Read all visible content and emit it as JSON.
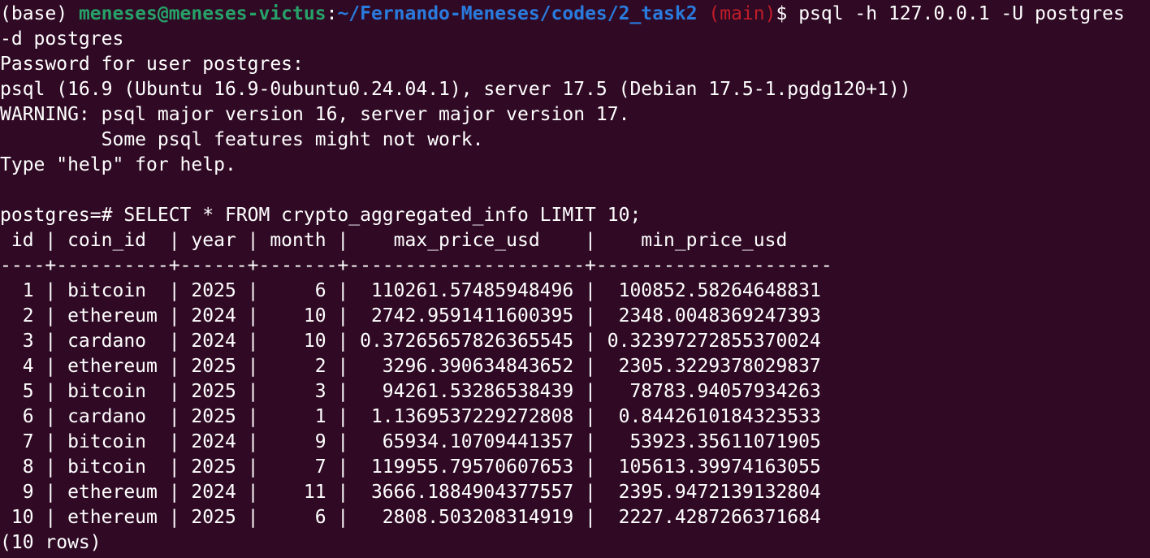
{
  "prompt": {
    "env": "(base) ",
    "user_host": "meneses@meneses-victus",
    "colon": ":",
    "path": "~/Fernando-Meneses/codes/2_task2",
    "branch": " (main)",
    "dollar": "$ ",
    "command": "psql -h 127.0.0.1 -U postgres",
    "command_cont": "-d postgres"
  },
  "output": {
    "password_prompt": "Password for user postgres:",
    "version_line": "psql (16.9 (Ubuntu 16.9-0ubuntu0.24.04.1), server 17.5 (Debian 17.5-1.pgdg120+1))",
    "warning_line1": "WARNING: psql major version 16, server major version 17.",
    "warning_line2": "         Some psql features might not work.",
    "help_line": "Type \"help\" for help.",
    "blank": "",
    "query_line": "postgres=# SELECT * FROM crypto_aggregated_info LIMIT 10;",
    "header_line": " id | coin_id  | year | month |    max_price_usd    |    min_price_usd",
    "separator_line": "----+----------+------+-------+---------------------+---------------------",
    "rows": [
      "  1 | bitcoin  | 2025 |     6 |  110261.57485948496 |  100852.58264648831",
      "  2 | ethereum | 2024 |    10 |  2742.9591411600395 |  2348.0048369247393",
      "  3 | cardano  | 2024 |    10 | 0.37265657826365545 | 0.32397272855370024",
      "  4 | ethereum | 2025 |     2 |   3296.390634843652 |  2305.3229378029837",
      "  5 | bitcoin  | 2025 |     3 |   94261.53286538439 |   78783.94057934263",
      "  6 | cardano  | 2025 |     1 |  1.1369537229272808 |  0.8442610184323533",
      "  7 | bitcoin  | 2024 |     9 |   65934.10709441357 |   53923.35611071905",
      "  8 | bitcoin  | 2025 |     7 |  119955.79570607653 |  105613.39974163055",
      "  9 | ethereum | 2024 |    11 |  3666.1884904377557 |  2395.9472139132804",
      " 10 | ethereum | 2025 |     6 |   2808.503208314919 |  2227.4287266371684"
    ],
    "rows_count": "(10 rows)"
  },
  "colors": {
    "background": "#300a24",
    "text": "#ffffff",
    "user_host": "#26a269",
    "path": "#2a7bde",
    "branch": "#c01c28"
  }
}
